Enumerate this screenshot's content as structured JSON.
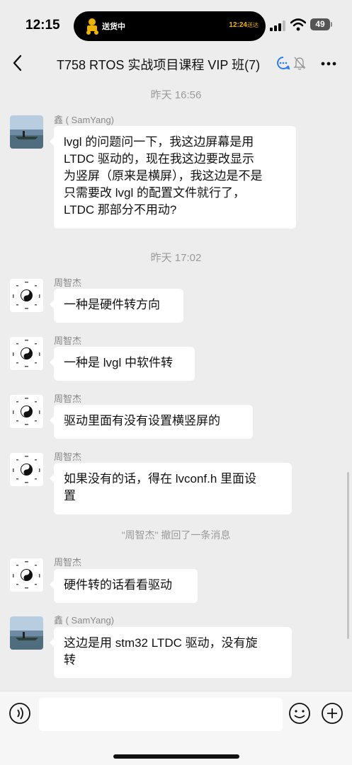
{
  "status_bar": {
    "time": "12:15",
    "island_label": "送货中",
    "island_time": "12:24",
    "island_time_suffix": "送达",
    "battery": "49"
  },
  "nav": {
    "title": "T758 RTOS 实战项目课程 VIP 班(7)"
  },
  "chat": {
    "timestamps": [
      "昨天 16:56",
      "昨天 17:02"
    ],
    "system_message": "\"周智杰\" 撤回了一条消息",
    "messages": [
      {
        "sender": "鑫 ( SamYang)",
        "avatar": "landscape-avatar",
        "lines": [
          "lvgl 的问题问一下，我这边屏幕是用",
          "LTDC 驱动的，现在我这边要改显示",
          "为竖屏（原来是横屏），我这边是不是",
          "只需要改 lvgl 的配置文件就行了，",
          "LTDC 那部分不用动?"
        ]
      },
      {
        "sender": "周智杰",
        "avatar": "yin-yang-avatar",
        "lines": [
          "一种是硬件转方向"
        ]
      },
      {
        "sender": "周智杰",
        "avatar": "yin-yang-avatar",
        "lines": [
          "一种是 lvgl 中软件转"
        ]
      },
      {
        "sender": "周智杰",
        "avatar": "yin-yang-avatar",
        "lines": [
          "驱动里面有没有设置横竖屏的"
        ]
      },
      {
        "sender": "周智杰",
        "avatar": "yin-yang-avatar",
        "lines": [
          "如果没有的话，得在 lvconf.h 里面设",
          "置"
        ]
      },
      {
        "sender": "周智杰",
        "avatar": "yin-yang-avatar",
        "lines": [
          "硬件转的话看看驱动"
        ]
      },
      {
        "sender": "鑫 ( SamYang)",
        "avatar": "landscape-avatar",
        "lines": [
          "这边是用 stm32 LTDC 驱动，没有旋",
          "转"
        ]
      }
    ]
  },
  "input_bar": {
    "placeholder": "",
    "icons": [
      "voice-icon",
      "emoji-icon",
      "plus-icon"
    ]
  },
  "colors": {
    "background": "#ededed",
    "bubble": "#ffffff",
    "meta_text": "#9a9a9a",
    "island_accent": "#f0b400"
  }
}
